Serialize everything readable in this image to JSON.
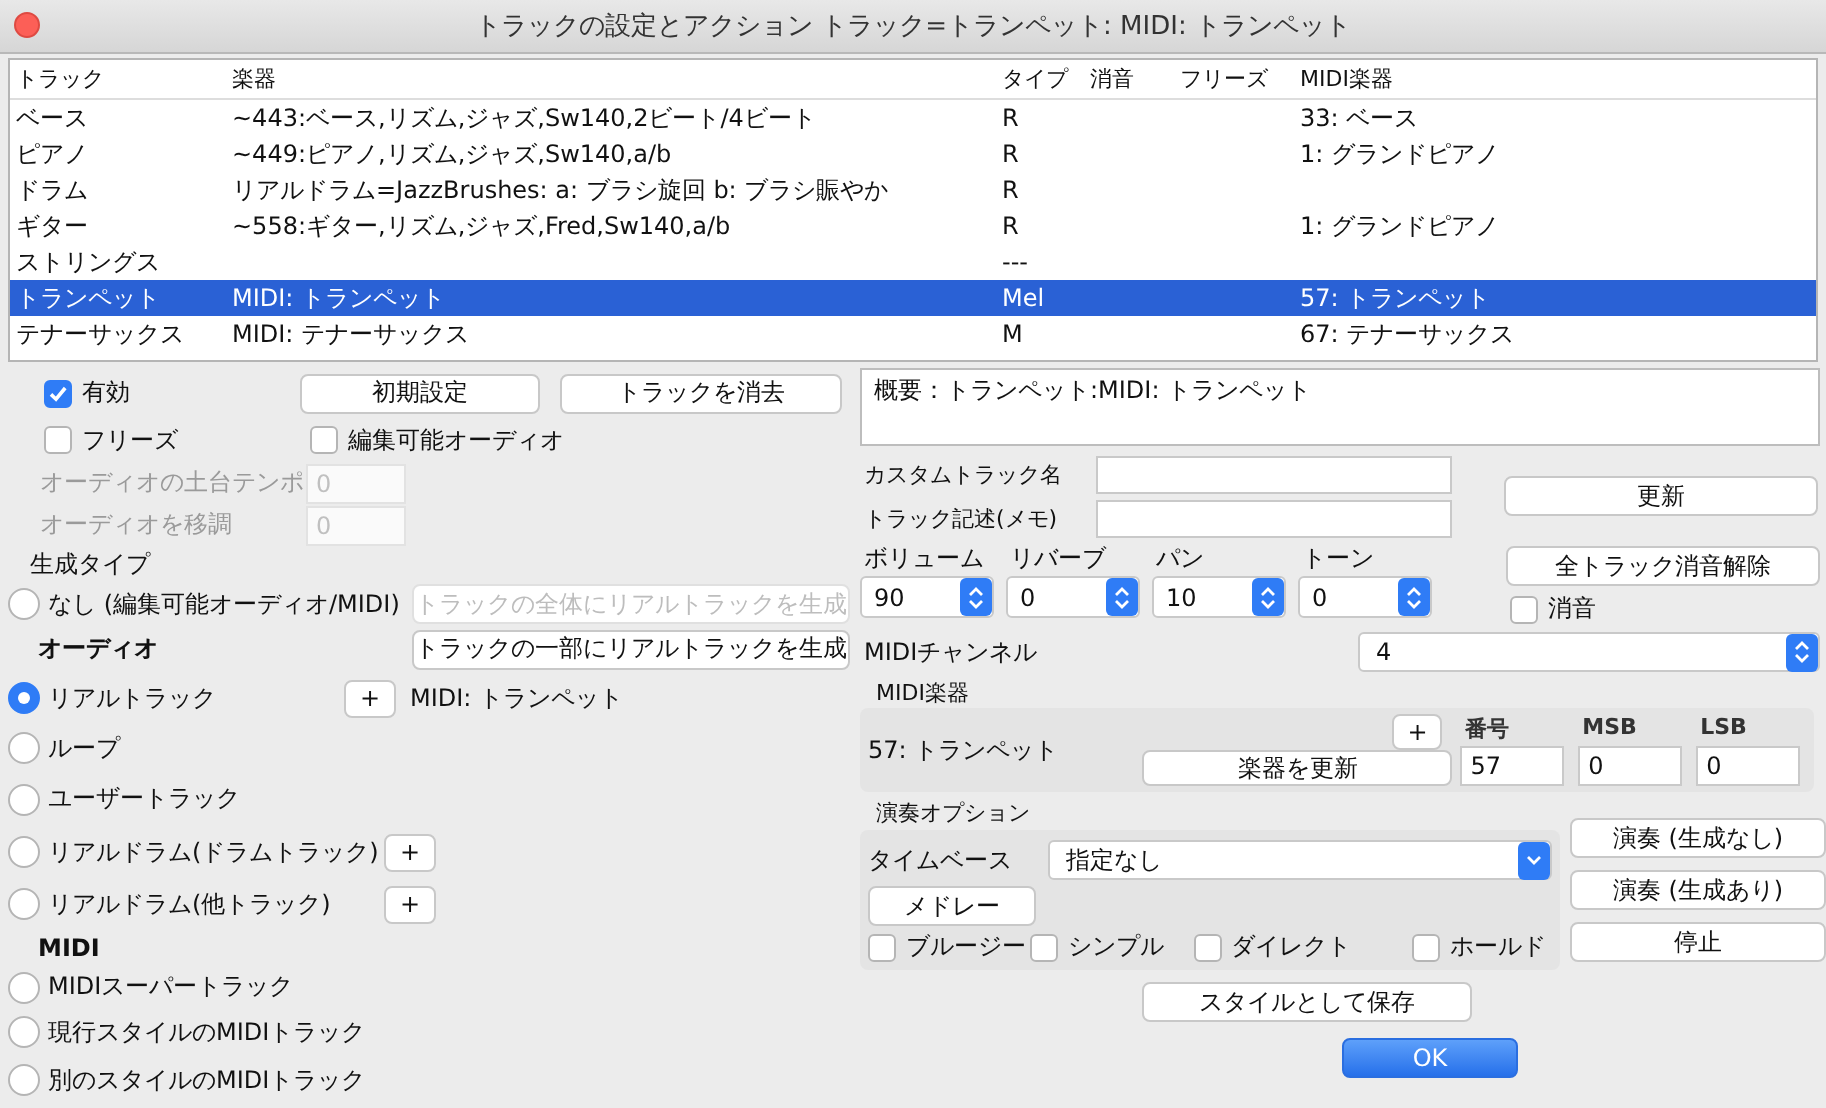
{
  "window": {
    "title": "トラックの設定とアクション  トラック=トランペット: MIDI: トランペット"
  },
  "table": {
    "columns": [
      "トラック",
      "楽器",
      "タイプ",
      "消音",
      "フリーズ",
      "MIDI楽器"
    ],
    "rows": [
      {
        "track": "ベース",
        "instrument": "~443:ベース,リズム,ジャズ,Sw140,2ビート/4ビート",
        "type": "R",
        "midi_instrument": "33: ベース",
        "selected": false
      },
      {
        "track": "ピアノ",
        "instrument": "~449:ピアノ,リズム,ジャズ,Sw140,a/b",
        "type": "R",
        "midi_instrument": "1: グランドピアノ",
        "selected": false
      },
      {
        "track": "ドラム",
        "instrument": "リアルドラム=JazzBrushes: a: ブラシ旋回 b: ブラシ賑やか",
        "type": "R",
        "selected": false
      },
      {
        "track": "ギター",
        "instrument": "~558:ギター,リズム,ジャズ,Fred,Sw140,a/b",
        "type": "R",
        "midi_instrument": "1: グランドピアノ",
        "selected": false
      },
      {
        "track": "ストリングス",
        "type": "---",
        "selected": false
      },
      {
        "track": "トランペット",
        "instrument": "MIDI: トランペット",
        "type": "Mel",
        "midi_instrument": "57: トランペット",
        "selected": true
      },
      {
        "track": "テナーサックス",
        "instrument": "MIDI: テナーサックス",
        "type": "M",
        "midi_instrument": "67: テナーサックス",
        "selected": false
      }
    ]
  },
  "left": {
    "enabled": {
      "label": "有効",
      "checked": true
    },
    "buttons": [
      "初期設定",
      "トラックを消去"
    ],
    "freeze": {
      "label": "フリーズ",
      "checked": false
    },
    "editable_audio": {
      "label": "編集可能オーディオ",
      "checked": false
    },
    "audio_fields": [
      {
        "label": "オーディオの土台テンポ",
        "value": "0",
        "disabled": true
      },
      {
        "label": "オーディオを移調",
        "value": "0",
        "disabled": true
      }
    ],
    "generation_type": {
      "title": "生成タイプ",
      "options": [
        {
          "kind": "radio",
          "label": "なし (編集可能オーディオ/MIDI)",
          "selected": false,
          "action": {
            "label": "トラックの全体にリアルトラックを生成",
            "disabled": true
          }
        },
        {
          "kind": "heading",
          "label": "オーディオ",
          "action": {
            "label": "トラックの一部にリアルトラックを生成",
            "disabled": false
          }
        },
        {
          "kind": "radio",
          "label": "リアルトラック",
          "selected": true,
          "plus": "+",
          "note": "MIDI: トランペット"
        },
        {
          "kind": "radio",
          "label": "ループ",
          "selected": false
        },
        {
          "kind": "radio",
          "label": "ユーザートラック",
          "selected": false
        },
        {
          "kind": "radio",
          "label": "リアルドラム(ドラムトラック)",
          "selected": false,
          "plus": "+"
        },
        {
          "kind": "radio",
          "label": "リアルドラム(他トラック)",
          "selected": false,
          "plus": "+"
        },
        {
          "kind": "heading",
          "label": "MIDI"
        },
        {
          "kind": "radio",
          "label": "MIDIスーパートラック",
          "selected": false
        },
        {
          "kind": "radio",
          "label": "現行スタイルのMIDIトラック",
          "selected": false
        },
        {
          "kind": "radio",
          "label": "別のスタイルのMIDIトラック",
          "selected": false
        }
      ]
    }
  },
  "right": {
    "summary": "概要：トランペット:MIDI: トランペット",
    "text_fields": [
      {
        "label": "カスタムトラック名"
      },
      {
        "label": "トラック記述(メモ)"
      }
    ],
    "update_button": "更新",
    "mixer": [
      {
        "label": "ボリューム",
        "value": "90"
      },
      {
        "label": "リバーブ",
        "value": "0"
      },
      {
        "label": "パン",
        "value": "10"
      },
      {
        "label": "トーン",
        "value": "0"
      }
    ],
    "unmute_all_button": "全トラック消音解除",
    "mute": {
      "label": "消音",
      "checked": false
    },
    "midi_channel": {
      "label": "MIDIチャンネル",
      "value": "4"
    },
    "midi_instrument": {
      "title": "MIDI楽器",
      "name": "57: トランペット",
      "plus": "+",
      "update_button": "楽器を更新",
      "fields": [
        {
          "label": "番号",
          "value": "57"
        },
        {
          "label": "MSB",
          "value": "0"
        },
        {
          "label": "LSB",
          "value": "0"
        }
      ]
    },
    "play_options": {
      "title": "演奏オプション",
      "timebase": {
        "label": "タイムベース",
        "value": "指定なし"
      },
      "medley_button": "メドレー",
      "checkboxes": [
        {
          "label": "ブルージー",
          "checked": false
        },
        {
          "label": "シンプル",
          "checked": false
        },
        {
          "label": "ダイレクト",
          "checked": false
        },
        {
          "label": "ホールド",
          "checked": false
        }
      ]
    },
    "play_buttons": [
      "演奏 (生成なし)",
      "演奏 (生成あり)",
      "停止"
    ],
    "save_style_button": "スタイルとして保存",
    "ok_button": "OK"
  }
}
